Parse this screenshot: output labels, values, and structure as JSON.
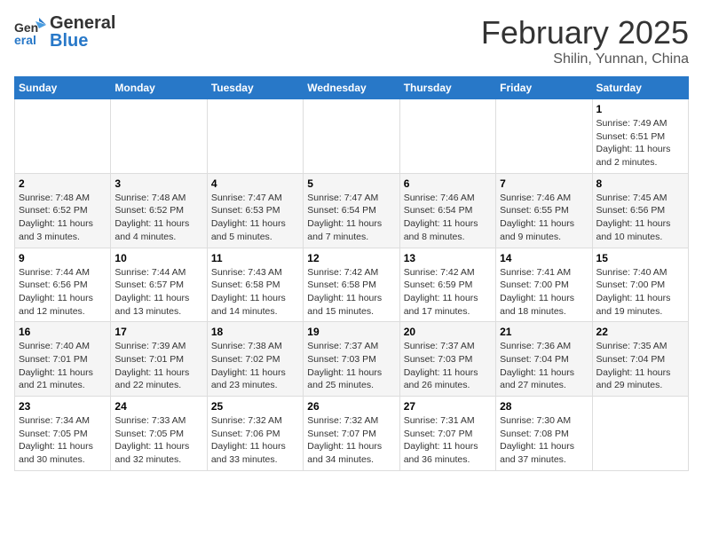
{
  "header": {
    "logo_general": "General",
    "logo_blue": "Blue",
    "title": "February 2025",
    "subtitle": "Shilin, Yunnan, China"
  },
  "days_of_week": [
    "Sunday",
    "Monday",
    "Tuesday",
    "Wednesday",
    "Thursday",
    "Friday",
    "Saturday"
  ],
  "weeks": [
    [
      {
        "day": "",
        "info": ""
      },
      {
        "day": "",
        "info": ""
      },
      {
        "day": "",
        "info": ""
      },
      {
        "day": "",
        "info": ""
      },
      {
        "day": "",
        "info": ""
      },
      {
        "day": "",
        "info": ""
      },
      {
        "day": "1",
        "info": "Sunrise: 7:49 AM\nSunset: 6:51 PM\nDaylight: 11 hours and 2 minutes."
      }
    ],
    [
      {
        "day": "2",
        "info": "Sunrise: 7:48 AM\nSunset: 6:52 PM\nDaylight: 11 hours and 3 minutes."
      },
      {
        "day": "3",
        "info": "Sunrise: 7:48 AM\nSunset: 6:52 PM\nDaylight: 11 hours and 4 minutes."
      },
      {
        "day": "4",
        "info": "Sunrise: 7:47 AM\nSunset: 6:53 PM\nDaylight: 11 hours and 5 minutes."
      },
      {
        "day": "5",
        "info": "Sunrise: 7:47 AM\nSunset: 6:54 PM\nDaylight: 11 hours and 7 minutes."
      },
      {
        "day": "6",
        "info": "Sunrise: 7:46 AM\nSunset: 6:54 PM\nDaylight: 11 hours and 8 minutes."
      },
      {
        "day": "7",
        "info": "Sunrise: 7:46 AM\nSunset: 6:55 PM\nDaylight: 11 hours and 9 minutes."
      },
      {
        "day": "8",
        "info": "Sunrise: 7:45 AM\nSunset: 6:56 PM\nDaylight: 11 hours and 10 minutes."
      }
    ],
    [
      {
        "day": "9",
        "info": "Sunrise: 7:44 AM\nSunset: 6:56 PM\nDaylight: 11 hours and 12 minutes."
      },
      {
        "day": "10",
        "info": "Sunrise: 7:44 AM\nSunset: 6:57 PM\nDaylight: 11 hours and 13 minutes."
      },
      {
        "day": "11",
        "info": "Sunrise: 7:43 AM\nSunset: 6:58 PM\nDaylight: 11 hours and 14 minutes."
      },
      {
        "day": "12",
        "info": "Sunrise: 7:42 AM\nSunset: 6:58 PM\nDaylight: 11 hours and 15 minutes."
      },
      {
        "day": "13",
        "info": "Sunrise: 7:42 AM\nSunset: 6:59 PM\nDaylight: 11 hours and 17 minutes."
      },
      {
        "day": "14",
        "info": "Sunrise: 7:41 AM\nSunset: 7:00 PM\nDaylight: 11 hours and 18 minutes."
      },
      {
        "day": "15",
        "info": "Sunrise: 7:40 AM\nSunset: 7:00 PM\nDaylight: 11 hours and 19 minutes."
      }
    ],
    [
      {
        "day": "16",
        "info": "Sunrise: 7:40 AM\nSunset: 7:01 PM\nDaylight: 11 hours and 21 minutes."
      },
      {
        "day": "17",
        "info": "Sunrise: 7:39 AM\nSunset: 7:01 PM\nDaylight: 11 hours and 22 minutes."
      },
      {
        "day": "18",
        "info": "Sunrise: 7:38 AM\nSunset: 7:02 PM\nDaylight: 11 hours and 23 minutes."
      },
      {
        "day": "19",
        "info": "Sunrise: 7:37 AM\nSunset: 7:03 PM\nDaylight: 11 hours and 25 minutes."
      },
      {
        "day": "20",
        "info": "Sunrise: 7:37 AM\nSunset: 7:03 PM\nDaylight: 11 hours and 26 minutes."
      },
      {
        "day": "21",
        "info": "Sunrise: 7:36 AM\nSunset: 7:04 PM\nDaylight: 11 hours and 27 minutes."
      },
      {
        "day": "22",
        "info": "Sunrise: 7:35 AM\nSunset: 7:04 PM\nDaylight: 11 hours and 29 minutes."
      }
    ],
    [
      {
        "day": "23",
        "info": "Sunrise: 7:34 AM\nSunset: 7:05 PM\nDaylight: 11 hours and 30 minutes."
      },
      {
        "day": "24",
        "info": "Sunrise: 7:33 AM\nSunset: 7:05 PM\nDaylight: 11 hours and 32 minutes."
      },
      {
        "day": "25",
        "info": "Sunrise: 7:32 AM\nSunset: 7:06 PM\nDaylight: 11 hours and 33 minutes."
      },
      {
        "day": "26",
        "info": "Sunrise: 7:32 AM\nSunset: 7:07 PM\nDaylight: 11 hours and 34 minutes."
      },
      {
        "day": "27",
        "info": "Sunrise: 7:31 AM\nSunset: 7:07 PM\nDaylight: 11 hours and 36 minutes."
      },
      {
        "day": "28",
        "info": "Sunrise: 7:30 AM\nSunset: 7:08 PM\nDaylight: 11 hours and 37 minutes."
      },
      {
        "day": "",
        "info": ""
      }
    ]
  ]
}
